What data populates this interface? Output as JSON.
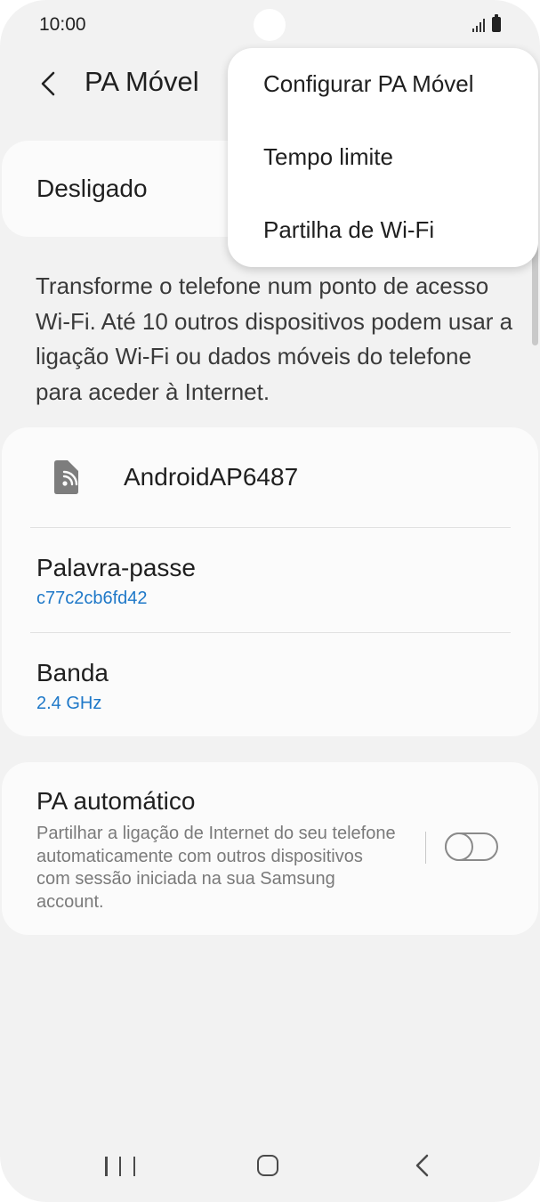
{
  "status_bar": {
    "time": "10:00"
  },
  "header": {
    "title": "PA Móvel",
    "back_icon": "chevron-left-icon"
  },
  "switch_card": {
    "label": "Desligado"
  },
  "description": "Transforme o telefone num ponto de acesso Wi-Fi. Até 10 outros dispositivos podem usar a ligação Wi-Fi ou dados móveis do telefone para aceder à Internet.",
  "details": {
    "ssid_icon": "hotspot-phone-icon",
    "ssid": "AndroidAP6487",
    "password": {
      "label": "Palavra-passe",
      "value": "c77c2cb6fd42"
    },
    "band": {
      "label": "Banda",
      "value": "2.4 GHz"
    }
  },
  "auto_hotspot": {
    "title": "PA automático",
    "description": "Partilhar a ligação de Internet do seu telefone automaticamente com outros dispositivos com sessão iniciada na sua Samsung account.",
    "enabled": false
  },
  "menu": {
    "items": [
      {
        "label": "Configurar PA Móvel"
      },
      {
        "label": "Tempo limite"
      },
      {
        "label": "Partilha de Wi-Fi"
      }
    ]
  },
  "colors": {
    "accent": "#1e78c8",
    "background": "#f2f2f2",
    "card": "#fbfbfb"
  }
}
